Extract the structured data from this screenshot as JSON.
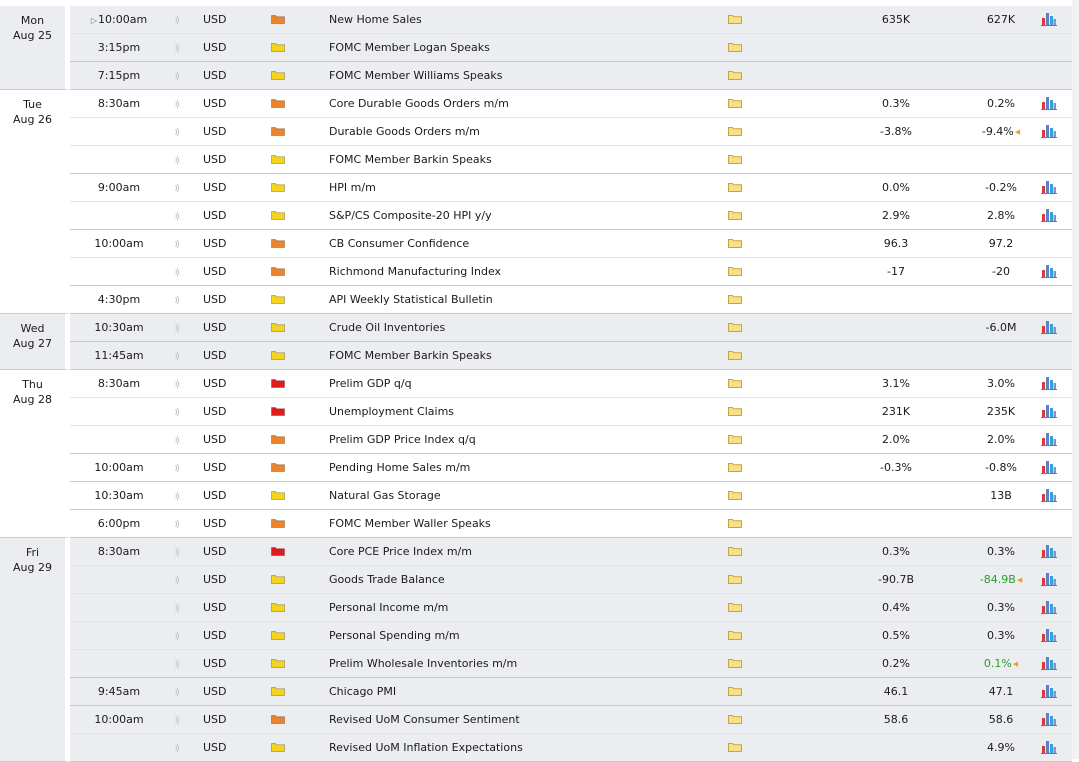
{
  "colors": {
    "high_impact": "#e01b1b",
    "medium_impact": "#f0832a",
    "low_impact": "#f5d51b",
    "better_forecast": "#2a9d2a"
  },
  "icons": {
    "impact": "impact-folder-icon",
    "detail": "detail-folder-icon",
    "sound": "sound-icon",
    "graph": "bar-graph-icon",
    "up_next": "play-triangle-icon",
    "revision": "revision-triangle-icon"
  },
  "days": [
    {
      "weekday": "Mon",
      "date": "Aug 25",
      "shade": true,
      "rows": [
        {
          "time": "10:00am",
          "next": true,
          "currency": "USD",
          "impact": "medium",
          "event": "New Home Sales",
          "actual": "635K",
          "forecast": "627K",
          "graph": true
        },
        {
          "time": "3:15pm",
          "currency": "USD",
          "impact": "low",
          "event": "FOMC Member Logan Speaks",
          "actual": "",
          "forecast": "",
          "graph": false,
          "group_end": true
        },
        {
          "time": "7:15pm",
          "currency": "USD",
          "impact": "low",
          "event": "FOMC Member Williams Speaks",
          "actual": "",
          "forecast": "",
          "graph": false
        }
      ]
    },
    {
      "weekday": "Tue",
      "date": "Aug 26",
      "shade": false,
      "rows": [
        {
          "time": "8:30am",
          "currency": "USD",
          "impact": "medium",
          "event": "Core Durable Goods Orders m/m",
          "actual": "0.3%",
          "forecast": "0.2%",
          "graph": true
        },
        {
          "time": "",
          "currency": "USD",
          "impact": "medium",
          "event": "Durable Goods Orders m/m",
          "actual": "-3.8%",
          "forecast": "-9.4%",
          "revised": true,
          "graph": true
        },
        {
          "time": "",
          "currency": "USD",
          "impact": "low",
          "event": "FOMC Member Barkin Speaks",
          "actual": "",
          "forecast": "",
          "graph": false,
          "group_end": true
        },
        {
          "time": "9:00am",
          "currency": "USD",
          "impact": "low",
          "event": "HPI m/m",
          "actual": "0.0%",
          "forecast": "-0.2%",
          "graph": true
        },
        {
          "time": "",
          "currency": "USD",
          "impact": "low",
          "event": "S&P/CS Composite-20 HPI y/y",
          "actual": "2.9%",
          "forecast": "2.8%",
          "graph": true,
          "group_end": true
        },
        {
          "time": "10:00am",
          "currency": "USD",
          "impact": "medium",
          "event": "CB Consumer Confidence",
          "actual": "96.3",
          "forecast": "97.2",
          "graph": false
        },
        {
          "time": "",
          "currency": "USD",
          "impact": "medium",
          "event": "Richmond Manufacturing Index",
          "actual": "-17",
          "forecast": "-20",
          "graph": true,
          "group_end": true
        },
        {
          "time": "4:30pm",
          "currency": "USD",
          "impact": "low",
          "event": "API Weekly Statistical Bulletin",
          "actual": "",
          "forecast": "",
          "graph": false
        }
      ]
    },
    {
      "weekday": "Wed",
      "date": "Aug 27",
      "shade": true,
      "rows": [
        {
          "time": "10:30am",
          "currency": "USD",
          "impact": "low",
          "event": "Crude Oil Inventories",
          "actual": "",
          "forecast": "-6.0M",
          "graph": true,
          "group_end": true
        },
        {
          "time": "11:45am",
          "currency": "USD",
          "impact": "low",
          "event": "FOMC Member Barkin Speaks",
          "actual": "",
          "forecast": "",
          "graph": false
        }
      ]
    },
    {
      "weekday": "Thu",
      "date": "Aug 28",
      "shade": false,
      "rows": [
        {
          "time": "8:30am",
          "currency": "USD",
          "impact": "high",
          "event": "Prelim GDP q/q",
          "actual": "3.1%",
          "forecast": "3.0%",
          "graph": true
        },
        {
          "time": "",
          "currency": "USD",
          "impact": "high",
          "event": "Unemployment Claims",
          "actual": "231K",
          "forecast": "235K",
          "graph": true
        },
        {
          "time": "",
          "currency": "USD",
          "impact": "medium",
          "event": "Prelim GDP Price Index q/q",
          "actual": "2.0%",
          "forecast": "2.0%",
          "graph": true,
          "group_end": true
        },
        {
          "time": "10:00am",
          "currency": "USD",
          "impact": "medium",
          "event": "Pending Home Sales m/m",
          "actual": "-0.3%",
          "forecast": "-0.8%",
          "graph": true,
          "group_end": true
        },
        {
          "time": "10:30am",
          "currency": "USD",
          "impact": "low",
          "event": "Natural Gas Storage",
          "actual": "",
          "forecast": "13B",
          "graph": true,
          "group_end": true
        },
        {
          "time": "6:00pm",
          "currency": "USD",
          "impact": "medium",
          "event": "FOMC Member Waller Speaks",
          "actual": "",
          "forecast": "",
          "graph": false
        }
      ]
    },
    {
      "weekday": "Fri",
      "date": "Aug 29",
      "shade": true,
      "rows": [
        {
          "time": "8:30am",
          "currency": "USD",
          "impact": "high",
          "event": "Core PCE Price Index m/m",
          "actual": "0.3%",
          "forecast": "0.3%",
          "graph": true
        },
        {
          "time": "",
          "currency": "USD",
          "impact": "low",
          "event": "Goods Trade Balance",
          "actual": "-90.7B",
          "forecast": "-84.9B",
          "forecast_better": true,
          "revised": true,
          "graph": true
        },
        {
          "time": "",
          "currency": "USD",
          "impact": "low",
          "event": "Personal Income m/m",
          "actual": "0.4%",
          "forecast": "0.3%",
          "graph": true
        },
        {
          "time": "",
          "currency": "USD",
          "impact": "low",
          "event": "Personal Spending m/m",
          "actual": "0.5%",
          "forecast": "0.3%",
          "graph": true
        },
        {
          "time": "",
          "currency": "USD",
          "impact": "low",
          "event": "Prelim Wholesale Inventories m/m",
          "actual": "0.2%",
          "forecast": "0.1%",
          "forecast_better": true,
          "revised": true,
          "graph": true,
          "group_end": true
        },
        {
          "time": "9:45am",
          "currency": "USD",
          "impact": "low",
          "event": "Chicago PMI",
          "actual": "46.1",
          "forecast": "47.1",
          "graph": true,
          "group_end": true
        },
        {
          "time": "10:00am",
          "currency": "USD",
          "impact": "medium",
          "event": "Revised UoM Consumer Sentiment",
          "actual": "58.6",
          "forecast": "58.6",
          "graph": true
        },
        {
          "time": "",
          "currency": "USD",
          "impact": "low",
          "event": "Revised UoM Inflation Expectations",
          "actual": "",
          "forecast": "4.9%",
          "graph": true
        }
      ]
    }
  ]
}
